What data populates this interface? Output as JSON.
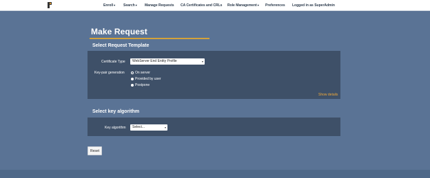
{
  "nav": {
    "items": [
      {
        "label": "Enroll",
        "caret": "▾"
      },
      {
        "label": "Search",
        "caret": "▾"
      },
      {
        "label": "Manage Requests"
      },
      {
        "label": "CA Certificates and CRLs"
      },
      {
        "label": "Role Management",
        "caret": "▾"
      },
      {
        "label": "Preferences"
      },
      {
        "label": "Logged in as SuperAdmin"
      }
    ]
  },
  "page": {
    "title": "Make Request"
  },
  "template_section": {
    "title": "Select Request Template",
    "cert_type_label": "Certificate Type",
    "cert_type_value": "WebServer End Entity Profile",
    "keypair_label": "Key-pair generation",
    "keypair_options": [
      {
        "label": "On server",
        "selected": false
      },
      {
        "label": "Provided by user",
        "selected": true
      },
      {
        "label": "Postpone",
        "selected": true
      }
    ],
    "show_details": "Show details"
  },
  "key_section": {
    "title": "Select key algorithm",
    "algo_label": "Key algorithm",
    "algo_value": "Select..."
  },
  "actions": {
    "reset": "Reset"
  },
  "colors": {
    "background": "#5a7395",
    "panel": "#3e5068",
    "accent": "#d4a23a",
    "link": "#f0a93a"
  }
}
